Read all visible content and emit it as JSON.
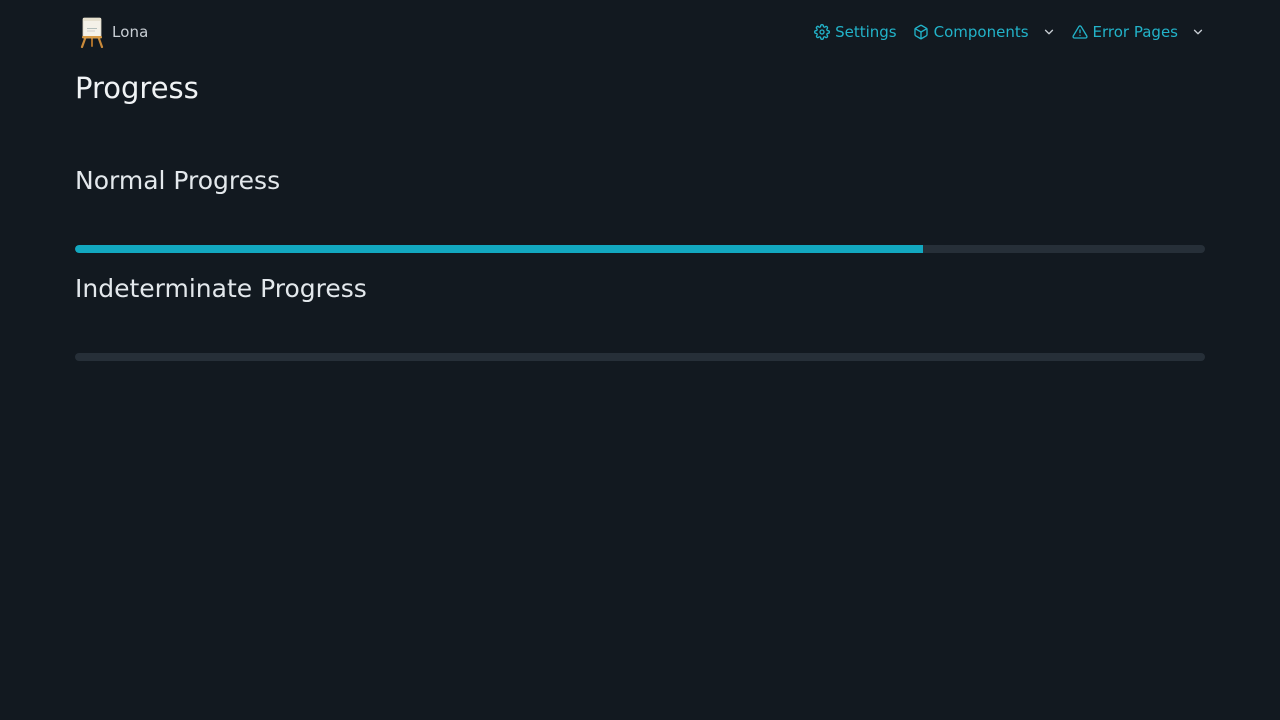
{
  "brand": {
    "name": "Lona",
    "logo_icon": "easel-logo-icon"
  },
  "nav": {
    "settings_label": "Settings",
    "settings_icon": "gear-icon",
    "components_label": "Components",
    "components_icon": "cube-icon",
    "error_pages_label": "Error Pages",
    "error_pages_icon": "warning-triangle-icon",
    "dropdown_icon": "chevron-down-icon"
  },
  "colors": {
    "background": "#121920",
    "accent": "#22b3c9",
    "progress_fill": "#12a8c0",
    "progress_track": "#262f38"
  },
  "page": {
    "title": "Progress"
  },
  "sections": {
    "normal": {
      "title": "Normal Progress",
      "value_fraction": 0.75
    },
    "indeterminate": {
      "title": "Indeterminate Progress"
    }
  }
}
